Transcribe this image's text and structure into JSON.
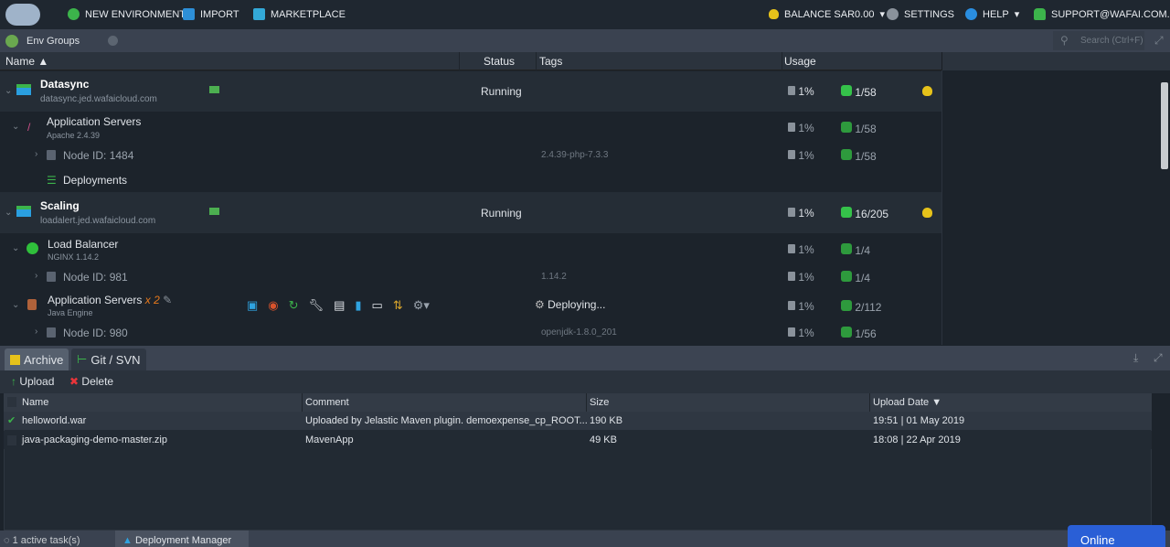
{
  "topbar": {
    "logo": "wafaicloud",
    "new_env": "NEW ENVIRONMENT",
    "import": "IMPORT",
    "marketplace": "MARKETPLACE",
    "balance": "BALANCE SAR0.00",
    "settings": "SETTINGS",
    "help": "HELP",
    "user": "SUPPORT@WAFAI.COM.SA"
  },
  "groups": {
    "label": "Env Groups",
    "search_placeholder": "Search (Ctrl+F)"
  },
  "columns": {
    "name": "Name",
    "status": "Status",
    "tags": "Tags",
    "usage": "Usage"
  },
  "envs": [
    {
      "name": "Datasync",
      "domain": "datasync.jed.wafaicloud.com",
      "status": "Running",
      "disk": "1%",
      "cloudlets": "1/58",
      "layers": [
        {
          "name": "Application Servers",
          "sub": "Apache 2.4.39",
          "disk": "1%",
          "cloudlets": "1/58",
          "node": {
            "label": "Node ID: 1484",
            "tag": "2.4.39-php-7.3.3",
            "disk": "1%",
            "cloudlets": "1/58"
          },
          "extra": "Deployments"
        }
      ]
    },
    {
      "name": "Scaling",
      "domain": "loadalert.jed.wafaicloud.com",
      "status": "Running",
      "disk": "1%",
      "cloudlets": "16/205",
      "layers": [
        {
          "name": "Load Balancer",
          "sub": "NGINX 1.14.2",
          "disk": "1%",
          "cloudlets": "1/4",
          "node": {
            "label": "Node ID: 981",
            "tag": "1.14.2",
            "disk": "1%",
            "cloudlets": "1/4"
          }
        },
        {
          "name": "Application Servers",
          "count": "x 2",
          "sub": "Java Engine",
          "status": "Deploying...",
          "disk": "1%",
          "cloudlets": "2/112",
          "node": {
            "label": "Node ID: 980",
            "tag": "openjdk-1.8.0_201",
            "disk": "1%",
            "cloudlets": "1/56"
          }
        }
      ]
    }
  ],
  "panel": {
    "tabs": [
      "Archive",
      "Git / SVN"
    ],
    "upload": "Upload",
    "delete": "Delete",
    "columns": {
      "name": "Name",
      "comment": "Comment",
      "size": "Size",
      "date": "Upload Date"
    },
    "rows": [
      {
        "name": "helloworld.war",
        "comment": "Uploaded by Jelastic Maven plugin. demoexpense_cp_ROOT...",
        "size": "190 KB",
        "date": "19:51 | 01 May 2019",
        "checked": true
      },
      {
        "name": "java-packaging-demo-master.zip",
        "comment": "MavenApp",
        "size": "49 KB",
        "date": "18:08 | 22 Apr 2019",
        "checked": false
      }
    ]
  },
  "statusbar": {
    "tasks": "1 active task(s)",
    "deploy_manager": "Deployment Manager",
    "online": "Online"
  },
  "colors": {
    "accent_green": "#35c24a",
    "online_blue": "#2a5fd6",
    "coin": "#e6c21a"
  }
}
